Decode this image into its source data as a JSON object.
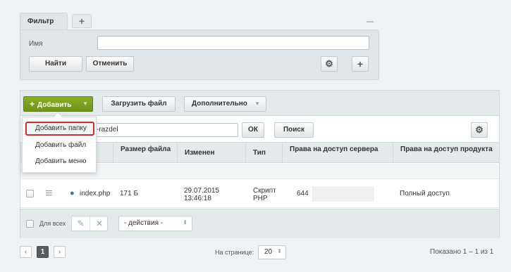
{
  "filter": {
    "tab_label": "Фильтр",
    "add_tab_icon": "plus-icon",
    "name_label": "Имя",
    "name_value": "",
    "find_button": "Найти",
    "cancel_button": "Отменить"
  },
  "toolbar": {
    "add_button": "Добавить",
    "upload_button": "Загрузить файл",
    "more_button": "Дополнительно"
  },
  "add_menu": {
    "items": [
      "Добавить папку",
      "Добавить файл",
      "Добавить меню"
    ],
    "highlighted_index": 0,
    "highlight_color": "#d22b2b"
  },
  "search": {
    "value": "-razdel",
    "ok_button": "ОК",
    "search_button": "Поиск"
  },
  "table": {
    "columns": {
      "size": "Размер файла",
      "changed": "Изменен",
      "type": "Тип",
      "server_access": "Права на доступ сервера",
      "product_access": "Права на доступ продукта"
    },
    "rows": [
      {
        "name": "index.php",
        "size": "171 Б",
        "date": "29.07.2015",
        "time": "13:46:18",
        "type_line1": "Скрипт",
        "type_line2": "PHP",
        "server_access": "644",
        "product_access": "Полный доступ"
      }
    ]
  },
  "footer": {
    "all_label": "Для всех",
    "actions_select": "- действия -"
  },
  "pagination": {
    "current_page": "1",
    "per_page_label": "На странице:",
    "per_page_value": "20",
    "total_label": "Показано 1 – 1 из 1"
  },
  "colors": {
    "accent_green": "#7aa21e",
    "highlight_red": "#d22b2b"
  }
}
